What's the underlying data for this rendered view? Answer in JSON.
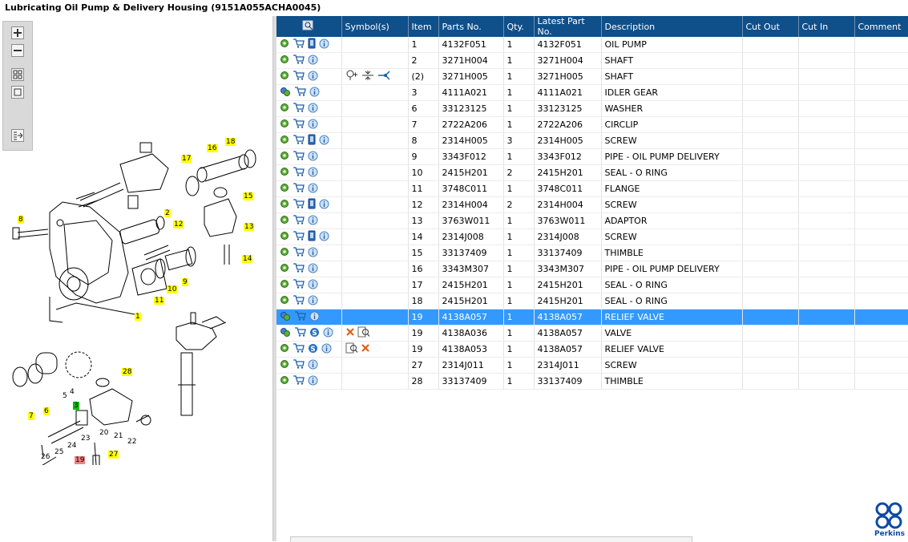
{
  "window": {
    "title": "Lubricating Oil Pump & Delivery Housing (9151A055ACHA0045)"
  },
  "toolbar": {
    "zoom_in_icon": "zoom-in-icon",
    "zoom_out_icon": "zoom-out-icon",
    "fit_icon": "fit-window-icon",
    "actual_size_icon": "actual-size-icon",
    "export_icon": "export-icon"
  },
  "diagram": {
    "callouts": [
      "8",
      "2",
      "12",
      "1",
      "10",
      "9",
      "11",
      "13",
      "14",
      "15",
      "16",
      "17",
      "18",
      "28",
      "3",
      "7",
      "6",
      "19",
      "27"
    ],
    "plain_labels": [
      "5",
      "4",
      "20",
      "21",
      "22",
      "23",
      "24",
      "25",
      "26"
    ]
  },
  "grid": {
    "columns": [
      "",
      "Symbol(s)",
      "Item",
      "Parts No.",
      "Qty.",
      "Latest Part No.",
      "Description",
      "Cut Out",
      "Cut In",
      "Comment"
    ],
    "rows": [
      {
        "item": "1",
        "part": "4132F051",
        "qty": "1",
        "latest": "4132F051",
        "desc": "OIL PUMP",
        "book": true,
        "s": false,
        "gearplus": false,
        "symbols": []
      },
      {
        "item": "2",
        "part": "3271H004",
        "qty": "1",
        "latest": "3271H004",
        "desc": "SHAFT",
        "book": false,
        "s": false,
        "gearplus": false,
        "symbols": []
      },
      {
        "item": "(2)",
        "part": "3271H005",
        "qty": "1",
        "latest": "3271H005",
        "desc": "SHAFT",
        "book": false,
        "s": false,
        "gearplus": false,
        "symbols": [
          "pin-marker-icon",
          "compress-arrows-icon",
          "merge-arrow-icon"
        ]
      },
      {
        "item": "3",
        "part": "4111A021",
        "qty": "1",
        "latest": "4111A021",
        "desc": "IDLER GEAR",
        "book": false,
        "s": false,
        "gearplus": true,
        "symbols": []
      },
      {
        "item": "6",
        "part": "33123125",
        "qty": "1",
        "latest": "33123125",
        "desc": "WASHER",
        "book": false,
        "s": false,
        "gearplus": false,
        "symbols": []
      },
      {
        "item": "7",
        "part": "2722A206",
        "qty": "1",
        "latest": "2722A206",
        "desc": "CIRCLIP",
        "book": false,
        "s": false,
        "gearplus": false,
        "symbols": []
      },
      {
        "item": "8",
        "part": "2314H005",
        "qty": "3",
        "latest": "2314H005",
        "desc": "SCREW",
        "book": true,
        "s": false,
        "gearplus": false,
        "symbols": []
      },
      {
        "item": "9",
        "part": "3343F012",
        "qty": "1",
        "latest": "3343F012",
        "desc": "PIPE - OIL PUMP DELIVERY",
        "book": false,
        "s": false,
        "gearplus": false,
        "symbols": []
      },
      {
        "item": "10",
        "part": "2415H201",
        "qty": "2",
        "latest": "2415H201",
        "desc": "SEAL - O RING",
        "book": false,
        "s": false,
        "gearplus": false,
        "symbols": []
      },
      {
        "item": "11",
        "part": "3748C011",
        "qty": "1",
        "latest": "3748C011",
        "desc": "FLANGE",
        "book": false,
        "s": false,
        "gearplus": false,
        "symbols": []
      },
      {
        "item": "12",
        "part": "2314H004",
        "qty": "2",
        "latest": "2314H004",
        "desc": "SCREW",
        "book": true,
        "s": false,
        "gearplus": false,
        "symbols": []
      },
      {
        "item": "13",
        "part": "3763W011",
        "qty": "1",
        "latest": "3763W011",
        "desc": "ADAPTOR",
        "book": false,
        "s": false,
        "gearplus": false,
        "symbols": []
      },
      {
        "item": "14",
        "part": "2314J008",
        "qty": "1",
        "latest": "2314J008",
        "desc": "SCREW",
        "book": true,
        "s": false,
        "gearplus": false,
        "symbols": []
      },
      {
        "item": "15",
        "part": "33137409",
        "qty": "1",
        "latest": "33137409",
        "desc": "THIMBLE",
        "book": false,
        "s": false,
        "gearplus": false,
        "symbols": []
      },
      {
        "item": "16",
        "part": "3343M307",
        "qty": "1",
        "latest": "3343M307",
        "desc": "PIPE - OIL PUMP DELIVERY",
        "book": false,
        "s": false,
        "gearplus": false,
        "symbols": []
      },
      {
        "item": "17",
        "part": "2415H201",
        "qty": "1",
        "latest": "2415H201",
        "desc": "SEAL - O RING",
        "book": false,
        "s": false,
        "gearplus": false,
        "symbols": []
      },
      {
        "item": "18",
        "part": "2415H201",
        "qty": "1",
        "latest": "2415H201",
        "desc": "SEAL - O RING",
        "book": false,
        "s": false,
        "gearplus": false,
        "symbols": []
      },
      {
        "item": "19",
        "part": "4138A057",
        "qty": "1",
        "latest": "4138A057",
        "desc": "RELIEF VALVE",
        "book": false,
        "s": false,
        "gearplus": true,
        "symbols": [],
        "selected": true
      },
      {
        "item": "19",
        "part": "4138A036",
        "qty": "1",
        "latest": "4138A057",
        "desc": "VALVE",
        "book": false,
        "s": true,
        "gearplus": true,
        "symbols": [
          "cross-icon",
          "magnify-doc-icon"
        ]
      },
      {
        "item": "19",
        "part": "4138A053",
        "qty": "1",
        "latest": "4138A057",
        "desc": "RELIEF VALVE",
        "book": false,
        "s": true,
        "gearplus": false,
        "symbols": [
          "magnify-doc-icon",
          "cross-icon"
        ]
      },
      {
        "item": "27",
        "part": "2314J011",
        "qty": "1",
        "latest": "2314J011",
        "desc": "SCREW",
        "book": false,
        "s": false,
        "gearplus": false,
        "symbols": []
      },
      {
        "item": "28",
        "part": "33137409",
        "qty": "1",
        "latest": "33137409",
        "desc": "THIMBLE",
        "book": false,
        "s": false,
        "gearplus": false,
        "symbols": []
      }
    ]
  },
  "logo": {
    "text": "Perkins",
    "mark": "®"
  },
  "colors": {
    "header_bg": "#0f4f8a",
    "selected_row": "#3399ff",
    "callout": "#ffff00",
    "callout_green": "#00c000",
    "callout_red": "#f08080",
    "brand_blue": "#0c4aa6"
  }
}
